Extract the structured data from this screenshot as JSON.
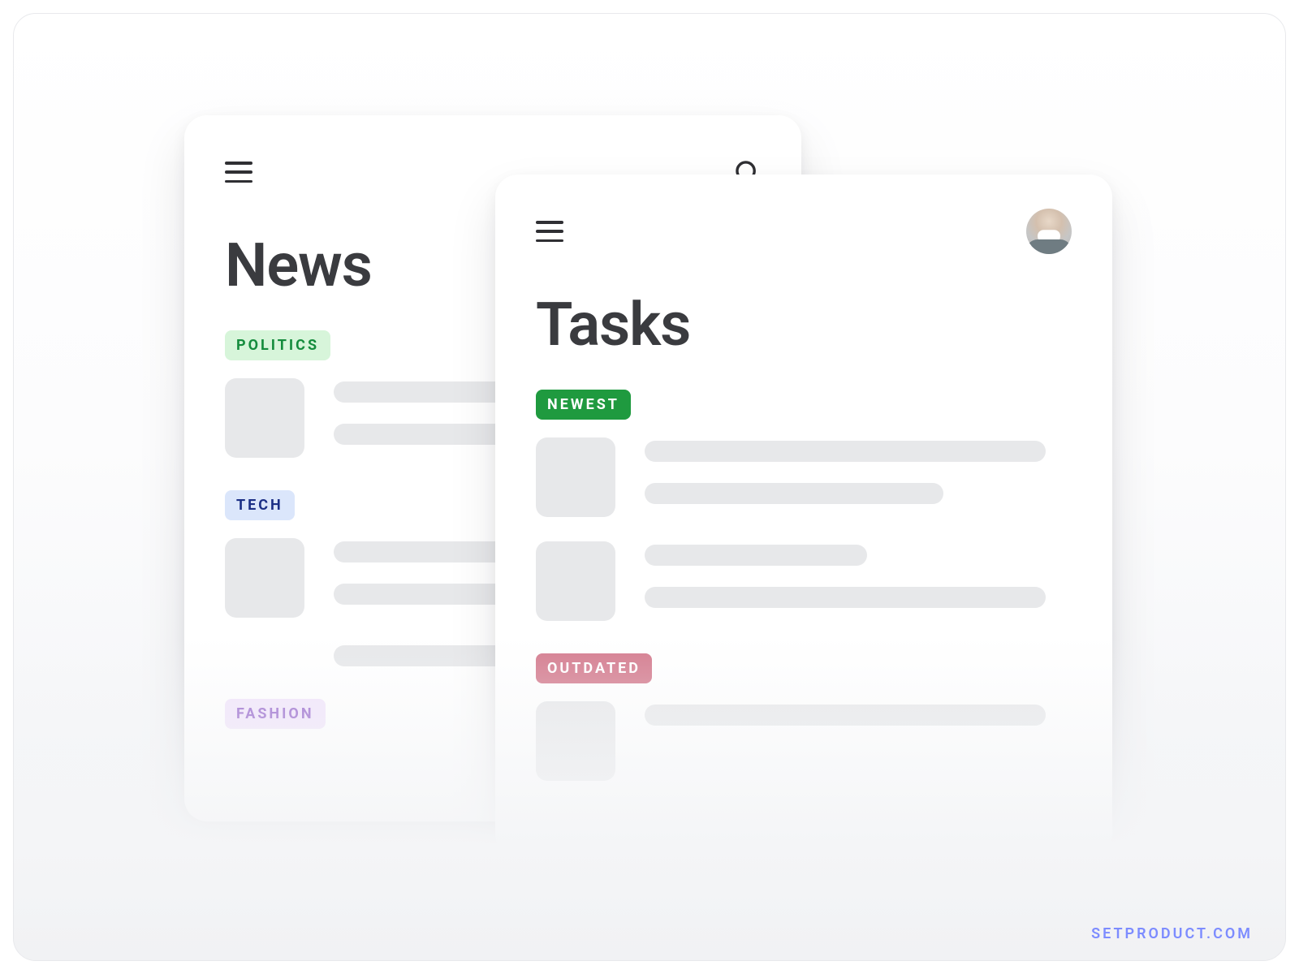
{
  "watermark": "SETPRODUCT.COM",
  "news": {
    "title": "News",
    "tags": {
      "politics": "POLITICS",
      "tech": "TECH",
      "fashion": "FASHION"
    }
  },
  "tasks": {
    "title": "Tasks",
    "tags": {
      "newest": "NEWEST",
      "outdated": "OUTDATED"
    }
  }
}
